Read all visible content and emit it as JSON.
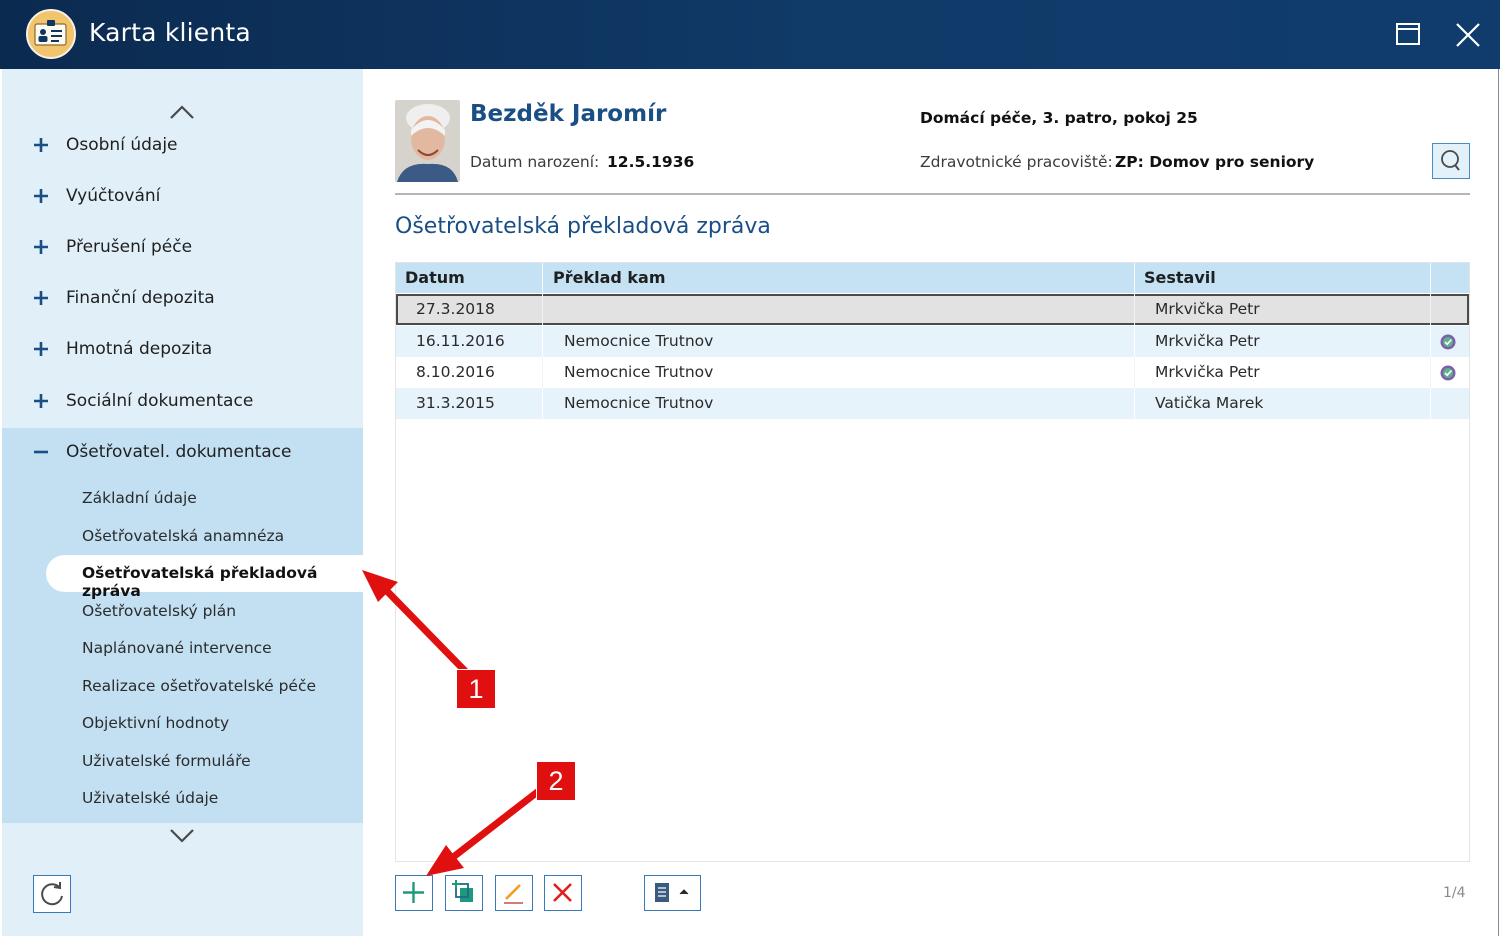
{
  "window": {
    "title": "Karta klienta",
    "icons": {
      "app": "id-card-icon",
      "maximize": "maximize-icon",
      "close": "close-icon"
    }
  },
  "sidebar": {
    "items": [
      {
        "label": "Osobní údaje",
        "expanded": false
      },
      {
        "label": "Vyúčtování",
        "expanded": false
      },
      {
        "label": "Přerušení péče",
        "expanded": false
      },
      {
        "label": "Finanční depozita",
        "expanded": false
      },
      {
        "label": "Hmotná depozita",
        "expanded": false
      },
      {
        "label": "Sociální dokumentace",
        "expanded": false
      },
      {
        "label": "Ošetřovatel. dokumentace",
        "expanded": true
      }
    ],
    "subitems": [
      "Základní údaje",
      "Ošetřovatelská anamnéza",
      "Ošetřovatelská překladová zpráva",
      "Ošetřovatelský plán",
      "Naplánované intervence",
      "Realizace ošetřovatelské péče",
      "Objektivní hodnoty",
      "Uživatelské formuláře",
      "Uživatelské údaje"
    ],
    "active_subitem": "Ošetřovatelská překladová zpráva",
    "icons": {
      "scroll_up": "chevron-up-icon",
      "scroll_down": "chevron-down-icon",
      "refresh": "refresh-icon"
    }
  },
  "client": {
    "name": "Bezděk Jaromír",
    "dob_label": "Datum narození:",
    "dob": "12.5.1936",
    "location": "Domácí péče, 3. patro, pokoj 25",
    "workplace_label": "Zdravotnické pracoviště:",
    "workplace": "ZP: Domov pro seniory"
  },
  "section": {
    "title": "Ošetřovatelská překladová zpráva"
  },
  "table": {
    "columns": [
      "Datum",
      "Překlad kam",
      "Sestavil"
    ],
    "rows": [
      {
        "date": "27.3.2018",
        "destination": "",
        "author": "Mrkvička Petr",
        "signed": false,
        "selected": true
      },
      {
        "date": "16.11.2016",
        "destination": "Nemocnice Trutnov",
        "author": "Mrkvička Petr",
        "signed": true,
        "selected": false
      },
      {
        "date": "8.10.2016",
        "destination": "Nemocnice Trutnov",
        "author": "Mrkvička Petr",
        "signed": true,
        "selected": false
      },
      {
        "date": "31.3.2015",
        "destination": "Nemocnice Trutnov",
        "author": "Vatička Marek",
        "signed": false,
        "selected": false
      }
    ]
  },
  "toolbar": {
    "buttons": [
      "add-icon",
      "copy-add-icon",
      "edit-pencil-icon",
      "delete-x-icon",
      "document-menu-icon"
    ],
    "pager": "1/4"
  },
  "annotations": {
    "callout_1": "1",
    "callout_2": "2"
  },
  "colors": {
    "titlebar": "#0f3562",
    "accent": "#1a4f86",
    "sidebar_bg": "#e1eff8",
    "sidebar_expanded_bg": "#c3e0f3",
    "table_header": "#c4e2f4",
    "callout": "#e01010"
  }
}
